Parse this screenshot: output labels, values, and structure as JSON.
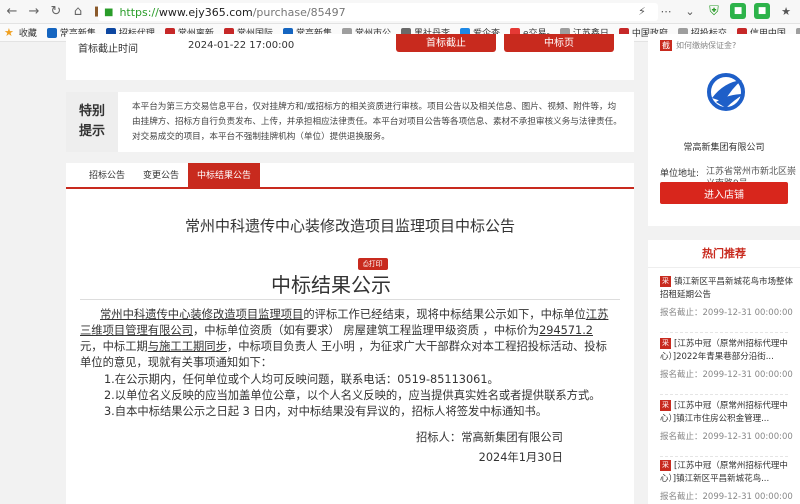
{
  "browser": {
    "url_protocol": "https://",
    "url_host": "www.ejy365.com",
    "url_path": "/purchase/85497",
    "bookmarks_label": "收藏",
    "bookmarks": [
      {
        "label": "常高新集",
        "color": "#1565c0"
      },
      {
        "label": "招标代理",
        "color": "#0d47a1"
      },
      {
        "label": "常州离新",
        "color": "#c62828"
      },
      {
        "label": "常州国际",
        "color": "#c62828"
      },
      {
        "label": "常高新集",
        "color": "#1565c0"
      },
      {
        "label": "常州市公",
        "color": "#9e9e9e"
      },
      {
        "label": "黑社丹李",
        "color": "#6a6a6a"
      },
      {
        "label": "爱企查",
        "color": "#1e88e5"
      },
      {
        "label": "e交易-",
        "color": "#e53935"
      },
      {
        "label": "江苏鑫日",
        "color": "#9e9e9e"
      },
      {
        "label": "中国政府",
        "color": "#c62828"
      },
      {
        "label": "招投标交",
        "color": "#9e9e9e"
      },
      {
        "label": "信用中国",
        "color": "#c62828"
      },
      {
        "label": "江苏省信",
        "color": "#9e9e9e"
      },
      {
        "label": "中华人民",
        "color": "#c62828"
      }
    ]
  },
  "top_panel": {
    "deadline_label": "首标截止时间",
    "deadline_value": "2024-01-22 17:00:00",
    "btn1": "首标截止",
    "btn2": "中标页"
  },
  "notice": {
    "label": "特别提示",
    "text": "本平台为第三方交易信息平台，仅对挂牌方和/或招标方的相关资质进行审核。项目公告以及相关信息、图片、视频、附件等，均由挂牌方、招标方自行负责发布、上传，并承担相应法律责任。本平台对项目公告等各项信息、素材不承担审核义务与法律责任。对交易成交的项目，本平台不强制挂牌机构（单位）提供退换服务。"
  },
  "tabs": [
    {
      "label": "招标公告",
      "active": false
    },
    {
      "label": "变更公告",
      "active": false
    },
    {
      "label": "中标结果公告",
      "active": true
    }
  ],
  "announcement": {
    "title": "常州中科遗传中心装修改造项目监理项目中标公告",
    "print_label": "打印",
    "result_title": "中标结果公示",
    "p1_a": "常州中科遗传中心装修改造项目监理项目",
    "p1_b": "的评标工作已经结束，现将中标结果公示如下，中标单位",
    "p1_c": "江苏三维项目管理有限公司",
    "p1_d": "，中标单位资质（如有要求） 房屋建筑工程监理甲级资质 ，中标价为",
    "p1_e": "294571.2",
    "p1_f": "元，中标工期",
    "p1_g": "与施工工期同步",
    "p1_h": "，中标项目负责人 王小明 ，为征求广大干部群众对本工程招投标活动、投标单位的意见，现就有关事项通知如下：",
    "item1": "1.在公示期内，任何单位或个人均可反映问题，联系电话：0519-85113061。",
    "item2": "2.以单位名义反映的应当加盖单位公章，以个人名义反映的，应当提供真实姓名或者提供联系方式。",
    "item3": "3.自本中标结果公示之日起 3 日内，对中标结果没有异议的，招标人将签发中标通知书。",
    "signer": "招标人：常高新集团有限公司",
    "date": "2024年1月30日"
  },
  "sidebar": {
    "top_link_badge": "截",
    "top_link_text": "如何缴纳保证金?",
    "company": "常高新集团有限公司",
    "address_label": "单位地址:",
    "address_value": "江苏省常州市新北区崇义南路9号",
    "enter_button": "进入店铺",
    "hot_title": "热门推荐",
    "hot_items": [
      {
        "badge": "采",
        "title": "镇江新区平昌新城花鸟市场整体招租延期公告",
        "deadline": "报名截止：2099-12-31 00:00:00"
      },
      {
        "badge": "采",
        "title": "[江苏中冠（原常州招标代理中心）]2022年青果巷部分沿街...",
        "deadline": "报名截止：2099-12-31 00:00:00"
      },
      {
        "badge": "采",
        "title": "[江苏中冠（原常州招标代理中心）]镇江市住房公积金管理...",
        "deadline": "报名截止：2099-12-31 00:00:00"
      },
      {
        "badge": "采",
        "title": "[江苏中冠（原常州招标代理中心）]镇江新区平昌新城花鸟...",
        "deadline": "报名截止：2099-12-31 00:00:00"
      }
    ]
  },
  "colors": {
    "accent": "#c82a1e",
    "logo_blue": "#1e5fc8"
  }
}
